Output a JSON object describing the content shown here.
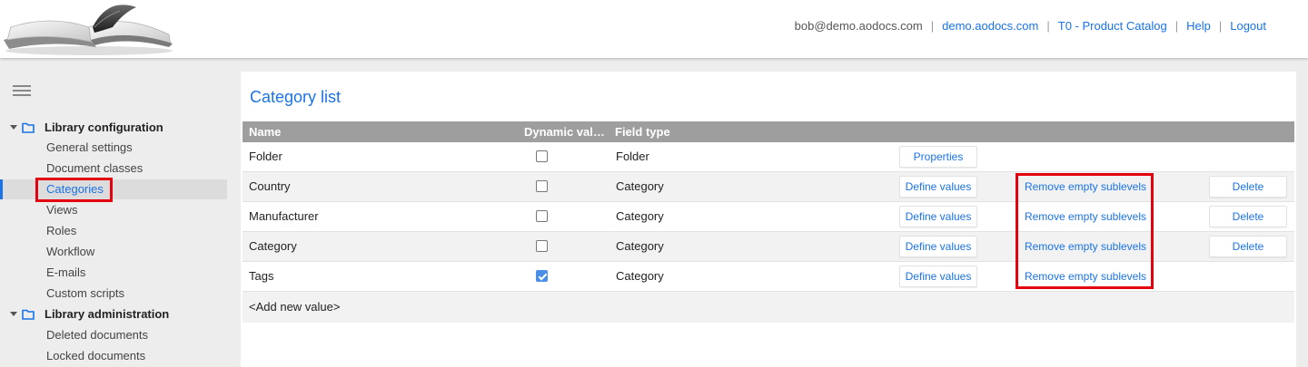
{
  "header": {
    "user_email": "bob@demo.aodocs.com",
    "domain_link": "demo.aodocs.com",
    "library_link": "T0 - Product Catalog",
    "help_link": "Help",
    "logout_link": "Logout",
    "separator": "|"
  },
  "sidebar": {
    "groups": [
      {
        "label": "Library configuration",
        "items": [
          "General settings",
          "Document classes",
          "Categories",
          "Views",
          "Roles",
          "Workflow",
          "E-mails",
          "Custom scripts"
        ]
      },
      {
        "label": "Library administration",
        "items": [
          "Deleted documents",
          "Locked documents"
        ]
      }
    ],
    "active_item": "Categories"
  },
  "main": {
    "title": "Category list",
    "columns": [
      "Name",
      "Dynamic val…",
      "Field type"
    ],
    "rows": [
      {
        "name": "Folder",
        "dynamic": false,
        "field_type": "Folder",
        "action": "Properties"
      },
      {
        "name": "Country",
        "dynamic": false,
        "field_type": "Category",
        "action": "Define values",
        "remove": "Remove empty sublevels",
        "delete": "Delete"
      },
      {
        "name": "Manufacturer",
        "dynamic": false,
        "field_type": "Category",
        "action": "Define values",
        "remove": "Remove empty sublevels",
        "delete": "Delete"
      },
      {
        "name": "Category",
        "dynamic": false,
        "field_type": "Category",
        "action": "Define values",
        "remove": "Remove empty sublevels",
        "delete": "Delete"
      },
      {
        "name": "Tags",
        "dynamic": true,
        "field_type": "Category",
        "action": "Define values",
        "remove": "Remove empty sublevels"
      }
    ],
    "add_new": "<Add new value>"
  },
  "colors": {
    "accent": "#1a73e8",
    "highlight": "#e3000f",
    "header_row": "#9e9e9e"
  },
  "icons": [
    "book-logo-icon",
    "hamburger-menu-icon",
    "caret-down-icon",
    "folder-icon"
  ]
}
